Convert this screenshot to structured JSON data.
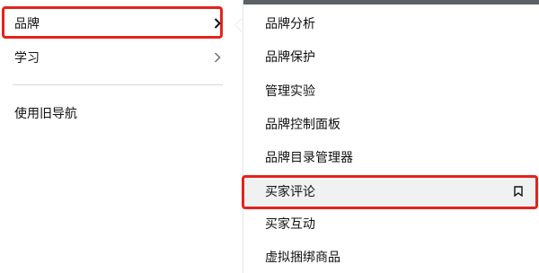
{
  "left_menu": {
    "items": [
      {
        "label": "品牌",
        "has_arrow": true,
        "active": true
      },
      {
        "label": "学习",
        "has_arrow": true,
        "active": false
      },
      {
        "label": "使用旧导航",
        "has_arrow": false,
        "active": false
      }
    ]
  },
  "submenu": {
    "items": [
      {
        "label": "品牌分析"
      },
      {
        "label": "品牌保护"
      },
      {
        "label": "管理实验"
      },
      {
        "label": "品牌控制面板"
      },
      {
        "label": "品牌目录管理器"
      },
      {
        "label": "买家评论",
        "highlighted": true,
        "bookmark_icon": "bookmark-icon"
      },
      {
        "label": "买家互动"
      },
      {
        "label": "虚拟捆绑商品"
      }
    ]
  },
  "colors": {
    "highlight_border": "#e4231d",
    "topbar": "#5b6166",
    "hover_bg": "#f0f2f2"
  }
}
